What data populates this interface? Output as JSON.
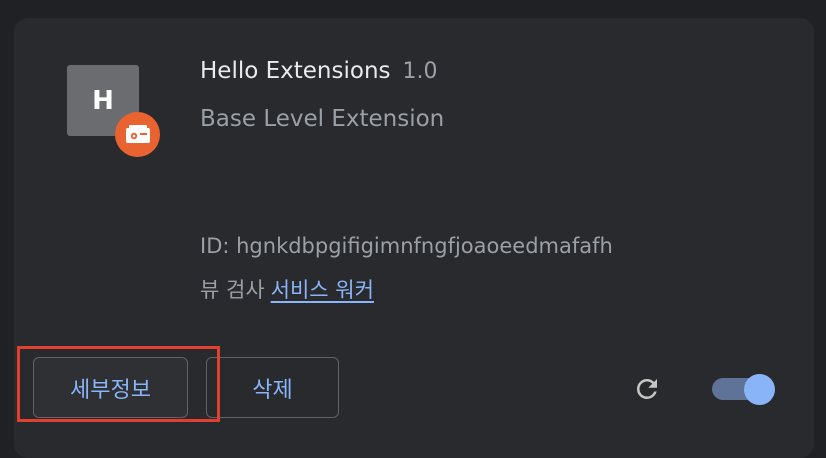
{
  "extension": {
    "icon_letter": "H",
    "badge_icon": "service-worker-badge-icon",
    "name": "Hello Extensions",
    "version": "1.0",
    "description": "Base Level Extension",
    "id_text": "ID: hgnkdbpgifigimnfngfjoaoeedmafafh",
    "inspect_label": "뷰 검사",
    "inspect_link": "서비스 워커"
  },
  "actions": {
    "details_label": "세부정보",
    "remove_label": "삭제",
    "reload_icon": "reload-icon",
    "enabled": true
  },
  "colors": {
    "background": "#202124",
    "card": "#292a2d",
    "accent": "#8ab4f8",
    "badge": "#e8632f",
    "highlight": "#e2402f"
  }
}
